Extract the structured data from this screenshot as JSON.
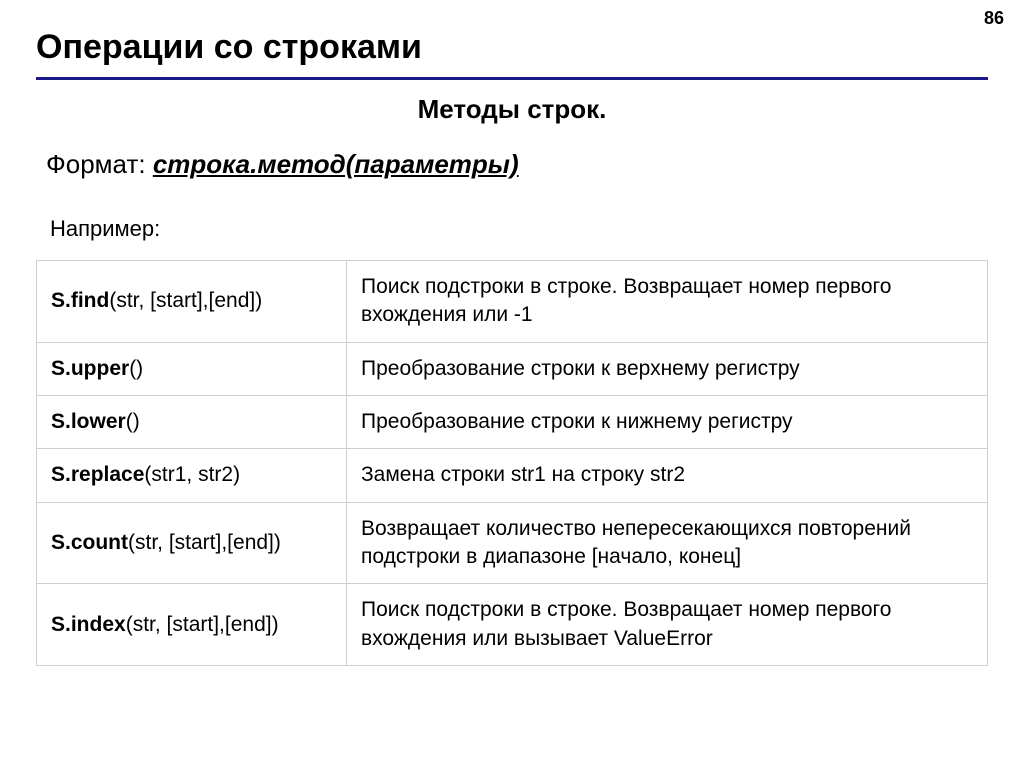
{
  "page_number": "86",
  "title": "Операции со строками",
  "subtitle": "Методы строк.",
  "format_label": "Формат: ",
  "format_value": "строка.метод(параметры)",
  "example_label": "Например:",
  "rows": [
    {
      "bold": "S.find",
      "args": "(str, [start],[end])",
      "desc": "Поиск подстроки в строке. Возвращает номер первого вхождения или -1"
    },
    {
      "bold": "S.upper",
      "args": "()",
      "desc": "Преобразование строки к верхнему регистру"
    },
    {
      "bold": "S.lower",
      "args": "()",
      "desc": "Преобразование строки к нижнему регистру"
    },
    {
      "bold": "S.replace",
      "args": "(str1, str2)",
      "desc": "Замена строки str1 на строку str2"
    },
    {
      "bold": "S.count",
      "args": "(str, [start],[end])",
      "desc": "Возвращает количество непересекающихся повторений подстроки в диапазоне [начало, конец]"
    },
    {
      "bold": "S.index",
      "args": "(str, [start],[end])",
      "desc": "Поиск подстроки в строке. Возвращает номер первого вхождения или вызывает ValueError"
    }
  ]
}
